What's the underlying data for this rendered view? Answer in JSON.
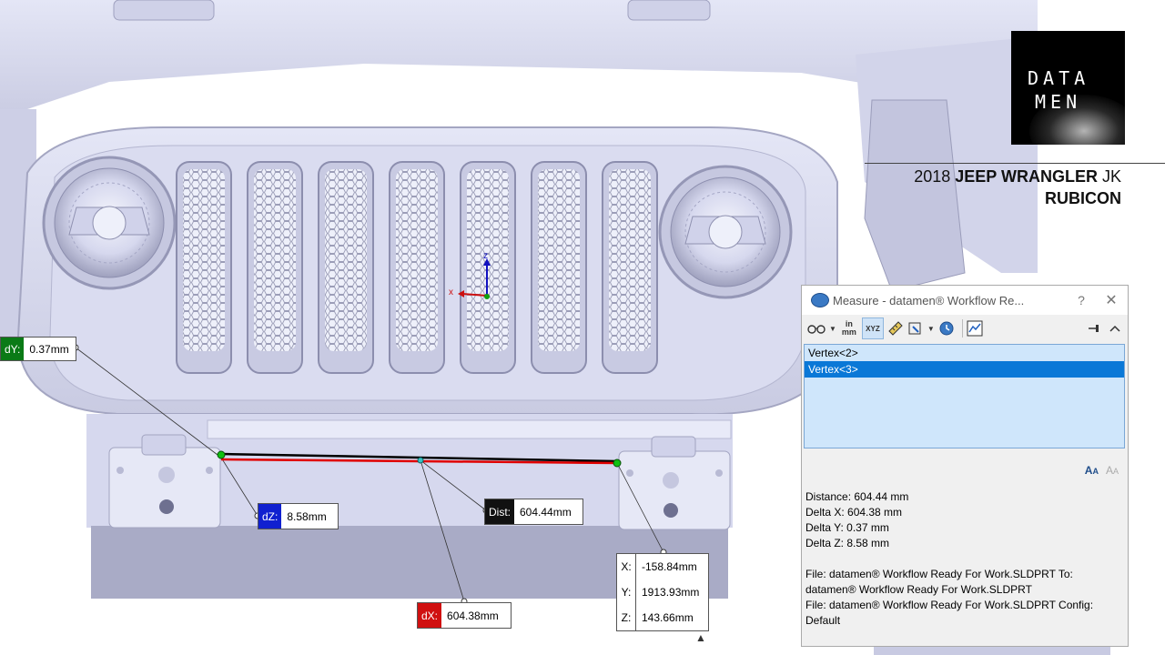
{
  "callouts": {
    "dy": {
      "tag": "dY:",
      "value": "0.37mm",
      "color": "#0a7a16"
    },
    "dz": {
      "tag": "dZ:",
      "value": "8.58mm",
      "color": "#1020d0"
    },
    "dist": {
      "tag": "Dist:",
      "value": "604.44mm",
      "color": "#111111"
    },
    "dx": {
      "tag": "dX:",
      "value": "604.38mm",
      "color": "#d01010"
    },
    "coords": [
      {
        "axis": "X:",
        "value": "-158.84mm"
      },
      {
        "axis": "Y:",
        "value": "1913.93mm"
      },
      {
        "axis": "Z:",
        "value": "143.66mm"
      }
    ]
  },
  "triad": {
    "z_label": "z",
    "x_label": "x"
  },
  "branding": {
    "logo_line1": "DATA",
    "logo_line2": "MEN",
    "title_year": "2018",
    "title_make_model": "JEEP WRANGLER",
    "title_trim": "JK",
    "title_line2": "RUBICON"
  },
  "measure_panel": {
    "title": "Measure - datamen® Workflow Re...",
    "help": "?",
    "close": "✕",
    "toolbar": {
      "arc_icon": "glasses-icon",
      "units_label": "in mm",
      "xyz_label": "XYZ",
      "point_to_point_icon": "ruler-icon",
      "projection_icon": "projection-icon",
      "history_icon": "history-icon",
      "sensor_icon": "graph-icon",
      "pin_icon": "pin-icon",
      "collapse_icon": "chevron-up-icon"
    },
    "selections": [
      {
        "label": "Vertex<2>",
        "selected": false
      },
      {
        "label": "Vertex<3>",
        "selected": true
      }
    ],
    "results": [
      "Distance: 604.44 mm",
      "Delta X: 604.38 mm",
      "Delta Y: 0.37 mm",
      "Delta Z: 8.58 mm"
    ],
    "file_info": [
      "File: datamen® Workflow Ready For Work.SLDPRT To:",
      "datamen® Workflow Ready For Work.SLDPRT",
      "File: datamen® Workflow Ready For Work.SLDPRT Config:",
      "Default"
    ]
  },
  "colors": {
    "model_fill": "#d8daf0",
    "model_shadow": "#aeb0c8",
    "measure_line": "#e00000",
    "accent_selected": "#0a78d7"
  }
}
